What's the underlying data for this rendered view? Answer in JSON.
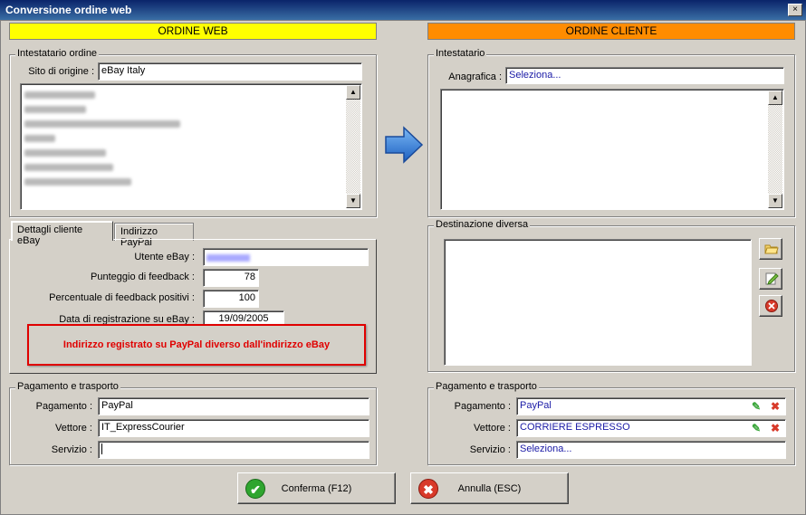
{
  "window": {
    "title": "Conversione ordine web",
    "close_symbol": "×"
  },
  "left": {
    "header": "ORDINE WEB",
    "header_color": "#ffff00",
    "intestatario": {
      "title": "Intestatario ordine",
      "site_label": "Sito di origine :",
      "site_value": "eBay Italy"
    },
    "tabs": [
      {
        "label": "Dettagli cliente eBay",
        "active": true
      },
      {
        "label": "Indirizzo PayPal",
        "active": false
      }
    ],
    "details": {
      "utente_label": "Utente eBay :",
      "punteggio_label": "Punteggio di feedback :",
      "punteggio_value": "78",
      "percentuale_label": "Percentuale di feedback positivi :",
      "percentuale_value": "100",
      "data_label": "Data di registrazione su eBay :",
      "data_value": "19/09/2005"
    },
    "warning": "Indirizzo registrato su PayPal diverso dall'indirizzo eBay",
    "warning_color": "#e00000",
    "pagamento": {
      "title": "Pagamento e trasporto",
      "pagamento_label": "Pagamento :",
      "pagamento_value": "PayPal",
      "vettore_label": "Vettore :",
      "vettore_value": "IT_ExpressCourier",
      "servizio_label": "Servizio :",
      "servizio_value": ""
    }
  },
  "right": {
    "header": "ORDINE CLIENTE",
    "header_color": "#ff8c00",
    "intestatario": {
      "title": "Intestatario",
      "anagrafica_label": "Anagrafica :",
      "anagrafica_value": "Seleziona..."
    },
    "destinazione": {
      "title": "Destinazione diversa"
    },
    "pagamento": {
      "title": "Pagamento e trasporto",
      "pagamento_label": "Pagamento :",
      "pagamento_value": "PayPal",
      "vettore_label": "Vettore :",
      "vettore_value": "CORRIERE ESPRESSO",
      "servizio_label": "Servizio :",
      "servizio_value": "Seleziona..."
    }
  },
  "buttons": {
    "conferma": "Conferma (F12)",
    "annulla": "Annulla (ESC)"
  },
  "colors": {
    "arrow": "#2a7fe0",
    "confirm": "#2fa52f",
    "cancel": "#d83a2a"
  }
}
